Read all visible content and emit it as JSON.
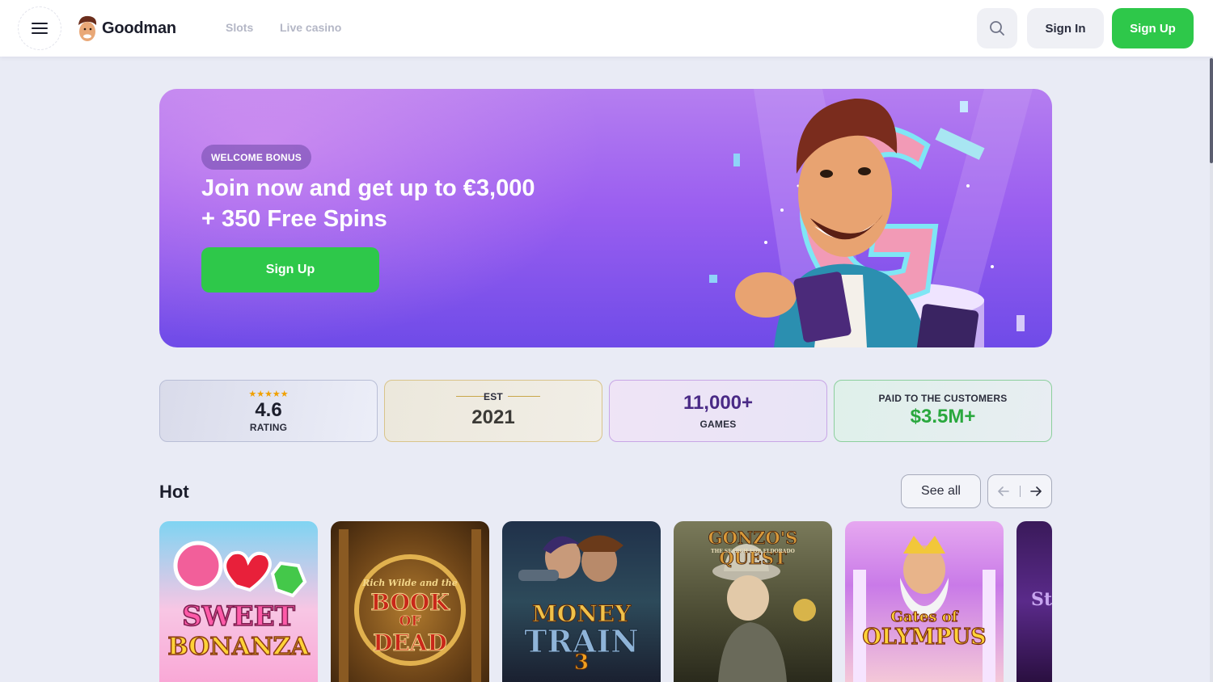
{
  "header": {
    "brand": "Goodman",
    "nav": [
      "Slots",
      "Live casino"
    ],
    "sign_in": "Sign In",
    "sign_up": "Sign Up"
  },
  "banner": {
    "badge": "WELCOME BONUS",
    "title": "Join now and get up to €3,000 + 350 Free Spins",
    "cta": "Sign Up"
  },
  "stats": {
    "rating": {
      "stars": "★★★★★",
      "value": "4.6",
      "label": "RATING"
    },
    "est": {
      "label": "EST",
      "value": "2021"
    },
    "games": {
      "value": "11,000+",
      "label": "GAMES"
    },
    "paid": {
      "label": "PAID TO THE CUSTOMERS",
      "value": "$3.5M+"
    }
  },
  "hot": {
    "title": "Hot",
    "see_all": "See all",
    "games": [
      {
        "name": "Sweet Bonanza",
        "line1": "SWEET",
        "line2": "BONANZA"
      },
      {
        "name": "Book of Dead",
        "line0": "Rich Wilde and the",
        "line1": "BOOK",
        "line2": "OF",
        "line3": "DEAD"
      },
      {
        "name": "Money Train 3",
        "line1": "MONEY",
        "line2": "TRAIN",
        "line3": "3"
      },
      {
        "name": "Gonzo's Quest",
        "line1": "GONZO'S QUEST",
        "line2": "THE SEARCH FOR ELDORADO"
      },
      {
        "name": "Gates of Olympus",
        "line1": "Gates of",
        "line2": "OLYMPUS"
      },
      {
        "name": "Starlight",
        "line1": "St"
      }
    ]
  },
  "colors": {
    "accent_green": "#2ec84a",
    "page_bg": "#e9ebf5",
    "banner_purple": "#9b5ff0"
  }
}
